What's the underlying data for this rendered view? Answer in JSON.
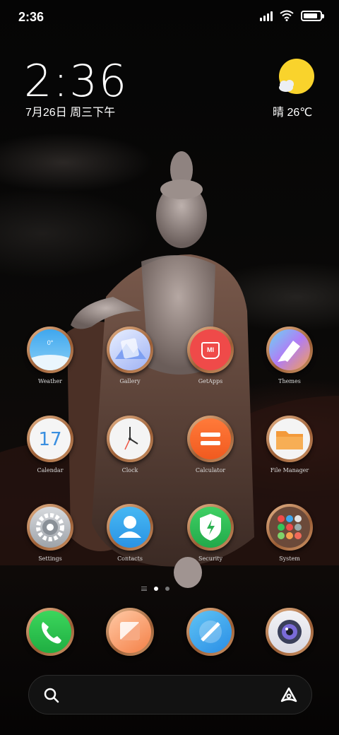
{
  "status_bar": {
    "time": "2:36",
    "battery_level": 0.85
  },
  "clock_widget": {
    "time": "2:36",
    "date": "7月26日 周三下午"
  },
  "weather_widget": {
    "text": "晴 26℃",
    "icon": "sunny-cloud-icon"
  },
  "page_1_apps": [
    {
      "label": "Weather",
      "icon": "weather-icon",
      "badge": "0°"
    },
    {
      "label": "Gallery",
      "icon": "gallery-icon"
    },
    {
      "label": "GetApps",
      "icon": "getapps-icon",
      "badge": "MI"
    },
    {
      "label": "Themes",
      "icon": "themes-icon"
    },
    {
      "label": "Calendar",
      "icon": "calendar-icon",
      "badge": "17"
    },
    {
      "label": "Clock",
      "icon": "clock-icon"
    },
    {
      "label": "Calculator",
      "icon": "calculator-icon"
    },
    {
      "label": "File Manager",
      "icon": "folder-icon"
    },
    {
      "label": "Settings",
      "icon": "gear-icon"
    },
    {
      "label": "Contacts",
      "icon": "contacts-icon"
    },
    {
      "label": "Security",
      "icon": "shield-icon"
    },
    {
      "label": "System",
      "icon": "folder-grid-icon"
    }
  ],
  "page_indicator": {
    "pages": 2,
    "current": 1
  },
  "dock": [
    {
      "icon": "phone-icon"
    },
    {
      "icon": "messages-icon"
    },
    {
      "icon": "browser-icon"
    },
    {
      "icon": "camera-icon"
    }
  ],
  "search_bar": {
    "search_icon": "search-icon",
    "assistant_icon": "assistant-icon"
  },
  "colors": {
    "frame": "#c9875a",
    "weather": "#5fb3ef",
    "getapps": "#f04b4b",
    "security": "#35c45a",
    "contacts": "#38a6ef",
    "files": "#f39a3b",
    "phone": "#2fc84e"
  }
}
